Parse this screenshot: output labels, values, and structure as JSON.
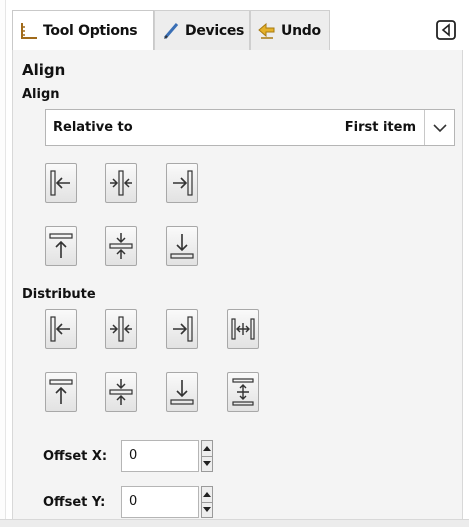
{
  "tabs": [
    {
      "label": "Tool Options",
      "icon": "tool-options-icon",
      "active": true
    },
    {
      "label": "Devices",
      "icon": "pen-icon",
      "active": false
    },
    {
      "label": "Undo",
      "icon": "undo-arrow-icon",
      "active": false
    }
  ],
  "tab_menu_icon": "configure-tab-icon",
  "panel": {
    "title": "Align",
    "align_section": "Align",
    "relative_label": "Relative to",
    "relative_value": "First item",
    "distribute_section": "Distribute"
  },
  "align_buttons": [
    {
      "icon": "align-left-edge-icon"
    },
    {
      "icon": "align-center-horizontal-icon"
    },
    {
      "icon": "align-right-edge-icon"
    },
    {
      "icon": "align-top-edge-icon"
    },
    {
      "icon": "align-middle-vertical-icon"
    },
    {
      "icon": "align-bottom-edge-icon"
    }
  ],
  "distribute_buttons": [
    {
      "icon": "distribute-left-edges-icon"
    },
    {
      "icon": "distribute-centers-horizontal-icon"
    },
    {
      "icon": "distribute-right-edges-icon"
    },
    {
      "icon": "distribute-even-horizontal-gaps-icon"
    },
    {
      "icon": "distribute-top-edges-icon"
    },
    {
      "icon": "distribute-centers-vertical-icon"
    },
    {
      "icon": "distribute-bottom-edges-icon"
    },
    {
      "icon": "distribute-even-vertical-gaps-icon"
    }
  ],
  "offset_x": {
    "label": "Offset X:",
    "value": "0"
  },
  "offset_y": {
    "label": "Offset Y:",
    "value": "0"
  },
  "colors": {
    "panel_bg": "#f4f4f4",
    "button_border": "#a8a8a8",
    "undo_icon": "#d9a514"
  }
}
